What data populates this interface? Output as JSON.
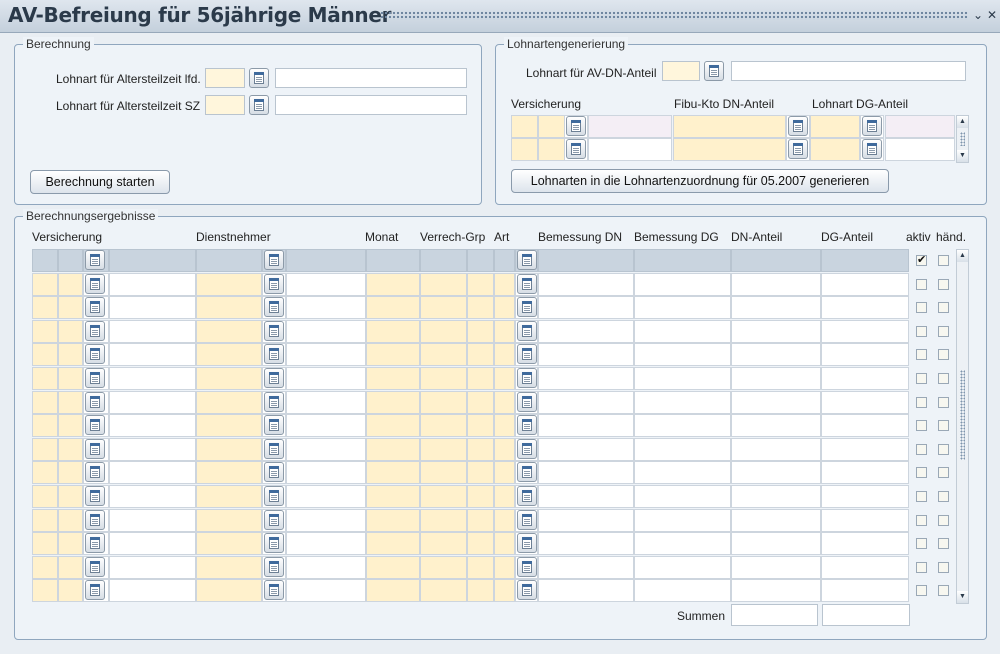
{
  "window": {
    "title": "AV-Befreiung für 56jährige Männer",
    "minimize_glyph": "⌄",
    "close_glyph": "✕"
  },
  "berechnung": {
    "legend": "Berechnung",
    "field1_label": "Lohnart für Altersteilzeit lfd.",
    "field2_label": "Lohnart für Altersteilzeit SZ",
    "start_button": "Berechnung starten"
  },
  "lohnartengenerierung": {
    "legend": "Lohnartengenerierung",
    "field_label": "Lohnart für AV-DN-Anteil",
    "columns": [
      "Versicherung",
      "Fibu-Kto DN-Anteil",
      "Lohnart DG-Anteil"
    ],
    "generate_button": "Lohnarten in die Lohnartenzuordnung für 05.2007 generieren"
  },
  "ergebnisse": {
    "legend": "Berechnungsergebnisse",
    "columns": [
      "Versicherung",
      "Dienstnehmer",
      "Monat",
      "Verrech-Grp",
      "Art",
      "Bemessung DN",
      "Bemessung DG",
      "DN-Anteil",
      "DG-Anteil",
      "aktiv",
      "händ."
    ],
    "first_row_aktiv_checked": true,
    "summen_label": "Summen"
  },
  "icons": {
    "lov": "list-of-values-icon",
    "checkmark": "checkmark-icon",
    "scroll_up": "scroll-up-arrow-icon",
    "scroll_down": "scroll-down-arrow-icon"
  },
  "colors": {
    "window_bg": "#e9eef3",
    "panel_border": "#8fa6be",
    "required_field": "#fff1cc",
    "header_row": "#c9d4df",
    "title_text": "#2b3a4a"
  }
}
